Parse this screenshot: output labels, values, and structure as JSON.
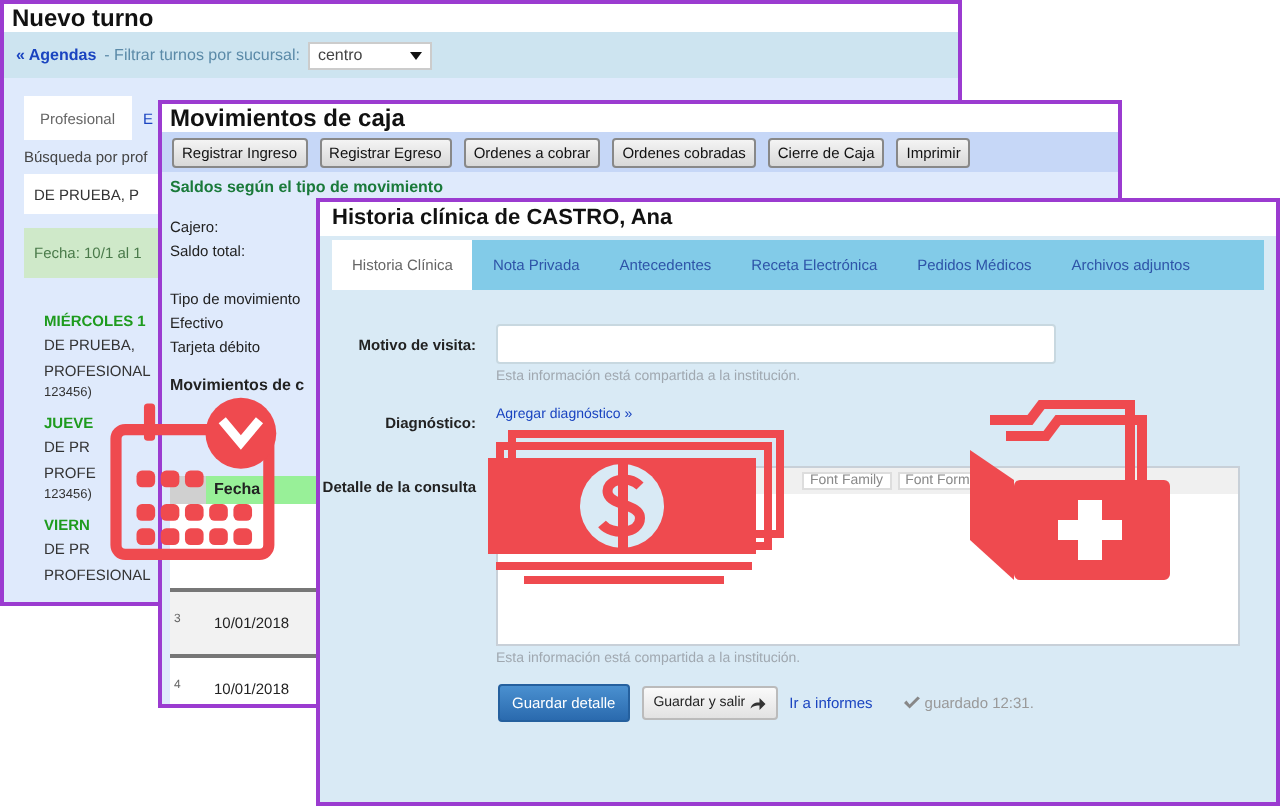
{
  "turnos_window": {
    "title": "Nuevo turno",
    "agendas_link": "« Agendas",
    "filter_label": "- Filtrar turnos por sucursal:",
    "branch_select": "centro",
    "tabs": [
      {
        "label": "Profesional",
        "selected": true
      },
      {
        "label": "E",
        "selected": false
      }
    ],
    "search_label": "Búsqueda por prof",
    "search_value": "DE PRUEBA, P",
    "date_range": "Fecha: 10/1 al 1",
    "days": [
      {
        "day": "MIÉRCOLES 1",
        "lines": [
          "DE PRUEBA,",
          "PROFESIONAL",
          "123456)"
        ]
      },
      {
        "day": "JUEVE",
        "lines": [
          "DE PR",
          "PROFE",
          "123456)"
        ]
      },
      {
        "day": "VIERN",
        "lines": [
          "DE PR",
          "PROFESIONAL"
        ]
      }
    ]
  },
  "caja_window": {
    "title": "Movimientos de caja",
    "buttons": [
      "Registrar Ingreso",
      "Registrar Egreso",
      "Ordenes a cobrar",
      "Ordenes cobradas",
      "Cierre de Caja",
      "Imprimir"
    ],
    "balances_heading": "Saldos según el tipo de movimiento",
    "labels": [
      "Cajero:",
      "Saldo total:"
    ],
    "types": [
      "Tipo de movimiento",
      "Efectivo",
      "Tarjeta débito"
    ],
    "movements_heading": "Movimientos de c",
    "table": {
      "columns": [
        "",
        "Fecha"
      ],
      "rows": [
        {
          "number": "3",
          "date": "10/01/2018"
        },
        {
          "number": "4",
          "date": "10/01/2018"
        }
      ]
    }
  },
  "historia_window": {
    "title": "Historia clínica de CASTRO, Ana",
    "tabs": [
      {
        "label": "Historia Clínica",
        "selected": true
      },
      {
        "label": "Nota Privada",
        "selected": false
      },
      {
        "label": "Antecedentes",
        "selected": false
      },
      {
        "label": "Receta Electrónica",
        "selected": false
      },
      {
        "label": "Pedidos Médicos",
        "selected": false
      },
      {
        "label": "Archivos adjuntos",
        "selected": false
      }
    ],
    "visit_label": "Motivo de visita:",
    "shared_hint": "Esta información está compartida a la institución.",
    "diagnosis_label": "Diagnóstico:",
    "diagnosis_link": "Agregar diagnóstico »",
    "detail_label": "Detalle de la consulta",
    "editor_selects": [
      "Font Family",
      "Font Form"
    ],
    "detail_hint": "Esta información está compartida a la institución.",
    "save_button": "Guardar detalle",
    "save_exit_button": "Guardar y salir",
    "reports_link": "Ir a informes",
    "saved_status": "guardado 12:31."
  }
}
